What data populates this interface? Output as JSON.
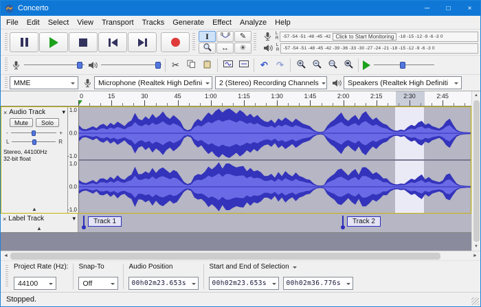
{
  "window": {
    "title": "Concerto"
  },
  "icons": {
    "minimize": "─",
    "maximize": "□",
    "close_win": "×",
    "dropdown": "▾",
    "collapse": "▲",
    "close": "×",
    "scissors": "✂",
    "pencil": "✎",
    "timeshift": "↔",
    "multitool": "✳",
    "ibeam": "I",
    "undo": "↶",
    "redo": "↷",
    "up": "▲",
    "down": "▼",
    "left": "◄",
    "right": "►"
  },
  "menu": {
    "items": [
      "File",
      "Edit",
      "Select",
      "View",
      "Transport",
      "Tracks",
      "Generate",
      "Effect",
      "Analyze",
      "Help"
    ]
  },
  "meters": {
    "left_label": "L",
    "right_label": "R",
    "record_scale_left": "-57  -54  -51  -48  -45  -42",
    "record_monitor": "Click to Start Monitoring",
    "record_scale_right": "-18  -15  -12   -9   -6   -3    0",
    "playback_scale": "-57 -54 -51 -48 -45 -42 -39 -36 -33 -30 -27 -24 -21 -18 -15 -12 -9 -6 -3 0"
  },
  "device": {
    "host": "MME",
    "recording_device": "Microphone (Realtek High Defini",
    "channels": "2 (Stereo) Recording Channels",
    "playback_device": "Speakers (Realtek High Definiti"
  },
  "timeline": {
    "total_seconds": 178,
    "labels": [
      {
        "s": 0,
        "t": "0"
      },
      {
        "s": 15,
        "t": "15"
      },
      {
        "s": 30,
        "t": "30"
      },
      {
        "s": 45,
        "t": "45"
      },
      {
        "s": 60,
        "t": "1:00"
      },
      {
        "s": 75,
        "t": "1:15"
      },
      {
        "s": 90,
        "t": "1:30"
      },
      {
        "s": 105,
        "t": "1:45"
      },
      {
        "s": 120,
        "t": "2:00"
      },
      {
        "s": 135,
        "t": "2:15"
      },
      {
        "s": 150,
        "t": "2:30"
      },
      {
        "s": 165,
        "t": "2:45"
      }
    ]
  },
  "selection": {
    "start_s": 143.653,
    "end_s": 156.776
  },
  "audio_track": {
    "name": "Audio Track",
    "mute": "Mute",
    "solo": "Solo",
    "gain_min": "-",
    "gain_max": "+",
    "pan_min": "L",
    "pan_max": "R",
    "info1": "Stereo, 44100Hz",
    "info2": "32-bit float",
    "vscale": [
      "1.0",
      "0.0",
      "-1.0"
    ]
  },
  "label_track": {
    "name": "Label Track",
    "labels": [
      {
        "text": "Track 1",
        "s": 2.2
      },
      {
        "text": "Track 2",
        "s": 119.5
      }
    ]
  },
  "waveform": {
    "peak_color": "#3333bb",
    "rms_color": "#6a6ae6",
    "peaks": [
      0.32,
      0.18,
      0.16,
      0.22,
      0.28,
      0.2,
      0.33,
      0.38,
      0.28,
      0.42,
      0.33,
      0.47,
      0.38,
      0.29,
      0.44,
      0.52,
      0.82,
      0.58,
      0.52,
      0.68,
      0.57,
      0.78,
      0.62,
      0.72,
      0.88,
      0.68,
      0.58,
      0.73,
      0.62,
      0.48,
      0.2,
      0.12,
      0.17,
      0.44,
      0.58,
      0.49,
      0.68,
      0.84,
      0.73,
      0.9,
      0.99,
      0.84,
      0.95,
      1.0,
      0.9,
      0.79,
      0.94,
      0.84,
      0.69,
      0.79,
      0.64,
      0.74,
      0.59,
      0.49,
      0.45,
      0.55,
      0.4,
      0.6,
      0.5,
      0.64,
      0.54,
      0.44,
      0.59,
      0.49,
      0.39,
      0.34,
      0.29,
      0.15,
      0.07,
      0.05,
      0.08,
      0.3,
      0.45,
      0.55,
      0.7,
      0.84,
      0.6,
      0.5,
      0.64,
      0.74,
      0.54,
      0.79,
      0.89,
      0.69,
      0.54,
      0.64,
      0.49,
      0.39,
      0.34,
      0.2,
      0.12,
      0.1,
      0.15,
      0.12,
      0.25,
      0.34,
      0.29,
      0.44,
      0.5,
      0.34,
      0.4,
      0.29,
      0.24,
      0.19,
      0.29,
      0.49,
      0.59,
      0.34,
      0.14,
      0.07,
      0.05,
      0.04,
      0.03
    ]
  },
  "bottom": {
    "project_rate_label": "Project Rate (Hz):",
    "project_rate": "44100",
    "snap_label": "Snap-To",
    "snap_value": "Off",
    "audio_position_label": "Audio Position",
    "audio_position": "00h02m23.653s",
    "selection_label": "Start and End of Selection",
    "selection_start": "00h02m23.653s",
    "selection_end": "00h02m36.776s"
  },
  "status": {
    "text": "Stopped."
  }
}
